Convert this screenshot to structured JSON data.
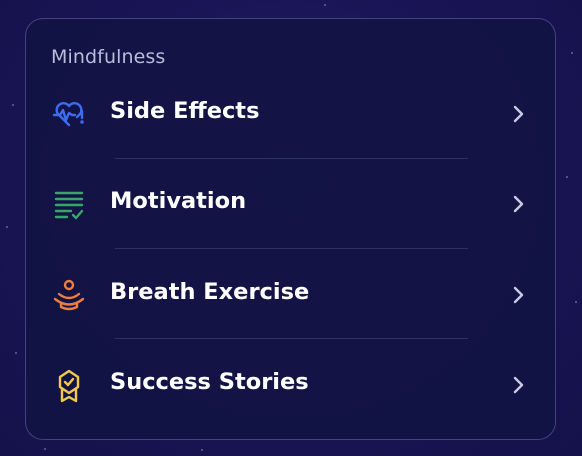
{
  "card": {
    "section_title": "Mindfulness",
    "items": [
      {
        "label": "Side Effects",
        "icon": "heartbeat-alert-icon",
        "color": "#3d6cf0"
      },
      {
        "label": "Motivation",
        "icon": "checklist-icon",
        "color": "#3aa56b"
      },
      {
        "label": "Breath Exercise",
        "icon": "meditation-icon",
        "color": "#f07d3a"
      },
      {
        "label": "Success Stories",
        "icon": "award-badge-icon",
        "color": "#f2c94c"
      }
    ]
  },
  "colors": {
    "background": "#1a1657",
    "card_background": "#121444",
    "text": "#ffffff",
    "section_title": "#b9bdd9"
  }
}
